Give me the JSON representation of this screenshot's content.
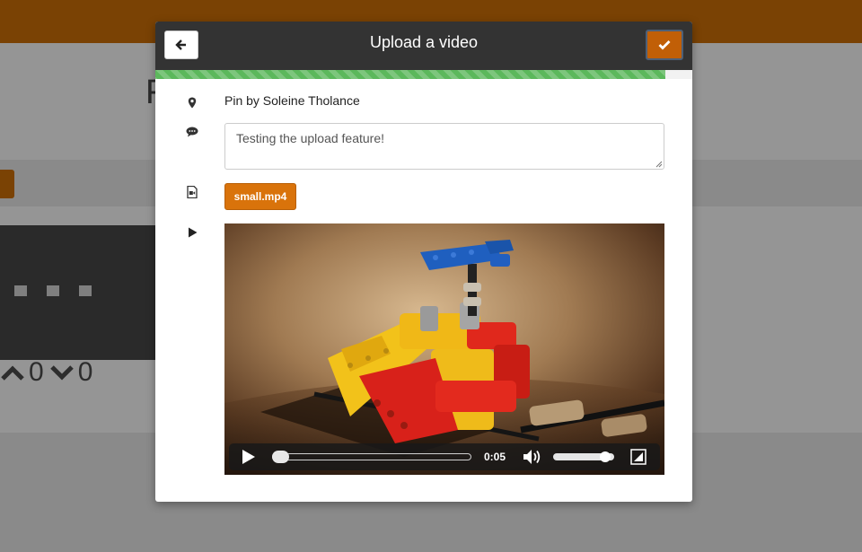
{
  "background": {
    "heading_fragment": "F",
    "upvote_count": "0",
    "downvote_count": "0"
  },
  "modal": {
    "title": "Upload a video",
    "back_icon": "arrow-left-icon",
    "confirm_icon": "check-icon",
    "upload_progress_percent": 95,
    "location_icon": "map-marker-icon",
    "pin_label": "Pin by Soleine Tholance",
    "comment_icon": "comment-icon",
    "comment_text": "Testing the upload feature!",
    "file_icon": "video-file-icon",
    "file_name": "small.mp4",
    "preview_icon": "play-icon",
    "player": {
      "time": "0:05",
      "playback_fraction": 0.0,
      "volume_fraction": 0.85
    }
  },
  "colors": {
    "accent": "#d9730b",
    "header_bar": "#7a4204",
    "modal_header": "#333333",
    "progress": "#5cb85c"
  }
}
